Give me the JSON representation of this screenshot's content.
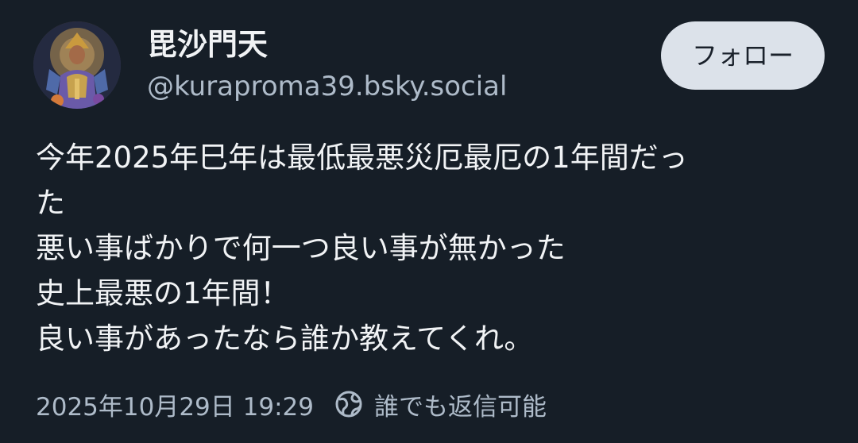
{
  "author": {
    "display_name": "毘沙門天",
    "handle": "@kuraproma39.bsky.social",
    "avatar_icon": "deity-portrait-avatar"
  },
  "follow_button": {
    "label": "フォロー"
  },
  "post": {
    "lines": [
      "今年2025年巳年は最低最悪災厄最厄の1年間だっ",
      "た",
      "悪い事ばかりで何一つ良い事が無かった",
      "史上最悪の1年間！",
      "良い事があったなら誰か教えてくれ。"
    ]
  },
  "meta": {
    "timestamp": "2025年10月29日 19:29",
    "reply_setting": "誰でも返信可能",
    "reply_setting_icon": "globe-icon"
  },
  "colors": {
    "background": "#161e27",
    "text": "#f1f3f5",
    "muted_text": "#aebbc9",
    "button_bg": "#dce2ea",
    "button_text": "#1a212b"
  }
}
